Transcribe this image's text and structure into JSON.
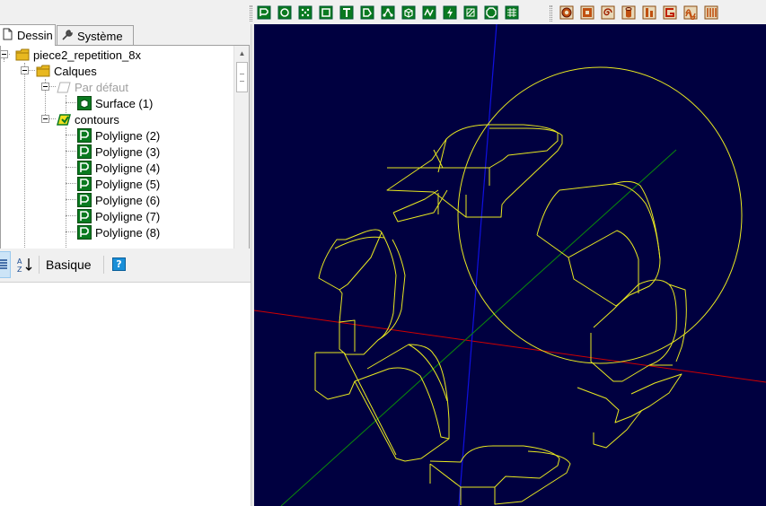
{
  "tabs": [
    {
      "label": "Dessin",
      "icon": "document-icon",
      "active": true
    },
    {
      "label": "Système",
      "icon": "wrench-icon",
      "active": false
    }
  ],
  "tree": {
    "root": "piece2_repetition_8x",
    "calques": "Calques",
    "par_defaut": "Par défaut",
    "surface": "Surface (1)",
    "contours": "contours",
    "polylignes": [
      "Polyligne (2)",
      "Polyligne (3)",
      "Polyligne (4)",
      "Polyligne (5)",
      "Polyligne (6)",
      "Polyligne (7)",
      "Polyligne (8)"
    ]
  },
  "properties": {
    "sort_label": "A↓Z",
    "mode_label": "Basique",
    "help_label": "?"
  },
  "toolbar_left_icons": [
    "polyline-icon",
    "circle-icon",
    "points-icon",
    "rectangle-icon",
    "text-icon",
    "polygon-icon",
    "nodes-icon",
    "box-icon",
    "wave-icon",
    "lightning-icon",
    "hatch-icon",
    "octagon-icon",
    "grid-icon"
  ],
  "toolbar_right_icons": [
    "ring-icon",
    "square-frame-icon",
    "spiral-icon",
    "cylinder-icon",
    "column-icon",
    "bracket-icon",
    "wave-bars-icon",
    "stripes-icon"
  ],
  "colors": {
    "viewport_bg": "#000040",
    "geometry": "#e8e820",
    "axis_x": "#d00000",
    "axis_y": "#1010e0",
    "axis_z": "#0a8a0a"
  }
}
